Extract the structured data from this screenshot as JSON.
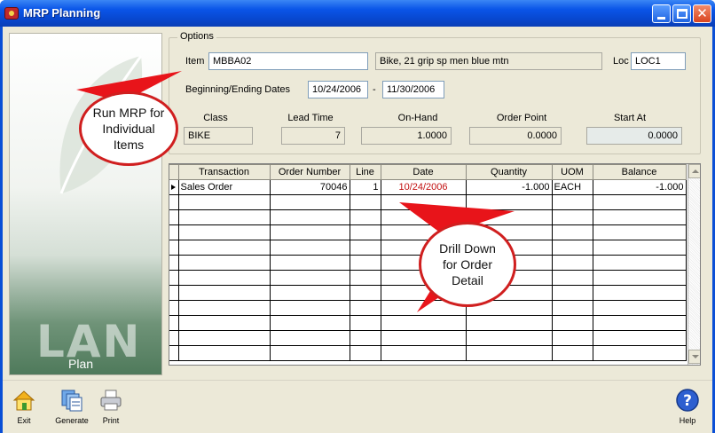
{
  "window": {
    "title": "MRP Planning"
  },
  "brand": {
    "big_text": "LAN",
    "sub_text": "Plan"
  },
  "options": {
    "legend": "Options",
    "item_label": "Item",
    "item_value": "MBBA02",
    "item_description": "Bike, 21 grip sp men blue mtn",
    "loc_label": "Loc",
    "loc_value": "LOC1",
    "dates_label": "Beginning/Ending Dates",
    "begin_date": "10/24/2006",
    "date_separator": "-",
    "end_date": "11/30/2006",
    "summary": {
      "class_label": "Class",
      "class_value": "BIKE",
      "lead_time_label": "Lead Time",
      "lead_time_value": "7",
      "on_hand_label": "On-Hand",
      "on_hand_value": "1.0000",
      "order_point_label": "Order Point",
      "order_point_value": "0.0000",
      "start_at_label": "Start At",
      "start_at_value": "0.0000"
    }
  },
  "grid": {
    "columns": [
      "Transaction",
      "Order Number",
      "Line",
      "Date",
      "Quantity",
      "UOM",
      "Balance"
    ],
    "rows": [
      {
        "transaction": "Sales Order",
        "order_number": "70046",
        "line": "1",
        "date": "10/24/2006",
        "quantity": "-1.000",
        "uom": "EACH",
        "balance": "-1.000"
      }
    ],
    "empty_row_count": 11
  },
  "toolbar": {
    "exit_label": "Exit",
    "generate_label": "Generate",
    "print_label": "Print",
    "help_label": "Help"
  },
  "callouts": {
    "run_mrp": "Run MRP for Individual Items",
    "drill_down": "Drill Down for Order Detail"
  },
  "colors": {
    "titlebar": "#0a55e8",
    "window_bg": "#ece9d8",
    "date_text": "#c21010",
    "callout_border": "#d01f1f"
  }
}
